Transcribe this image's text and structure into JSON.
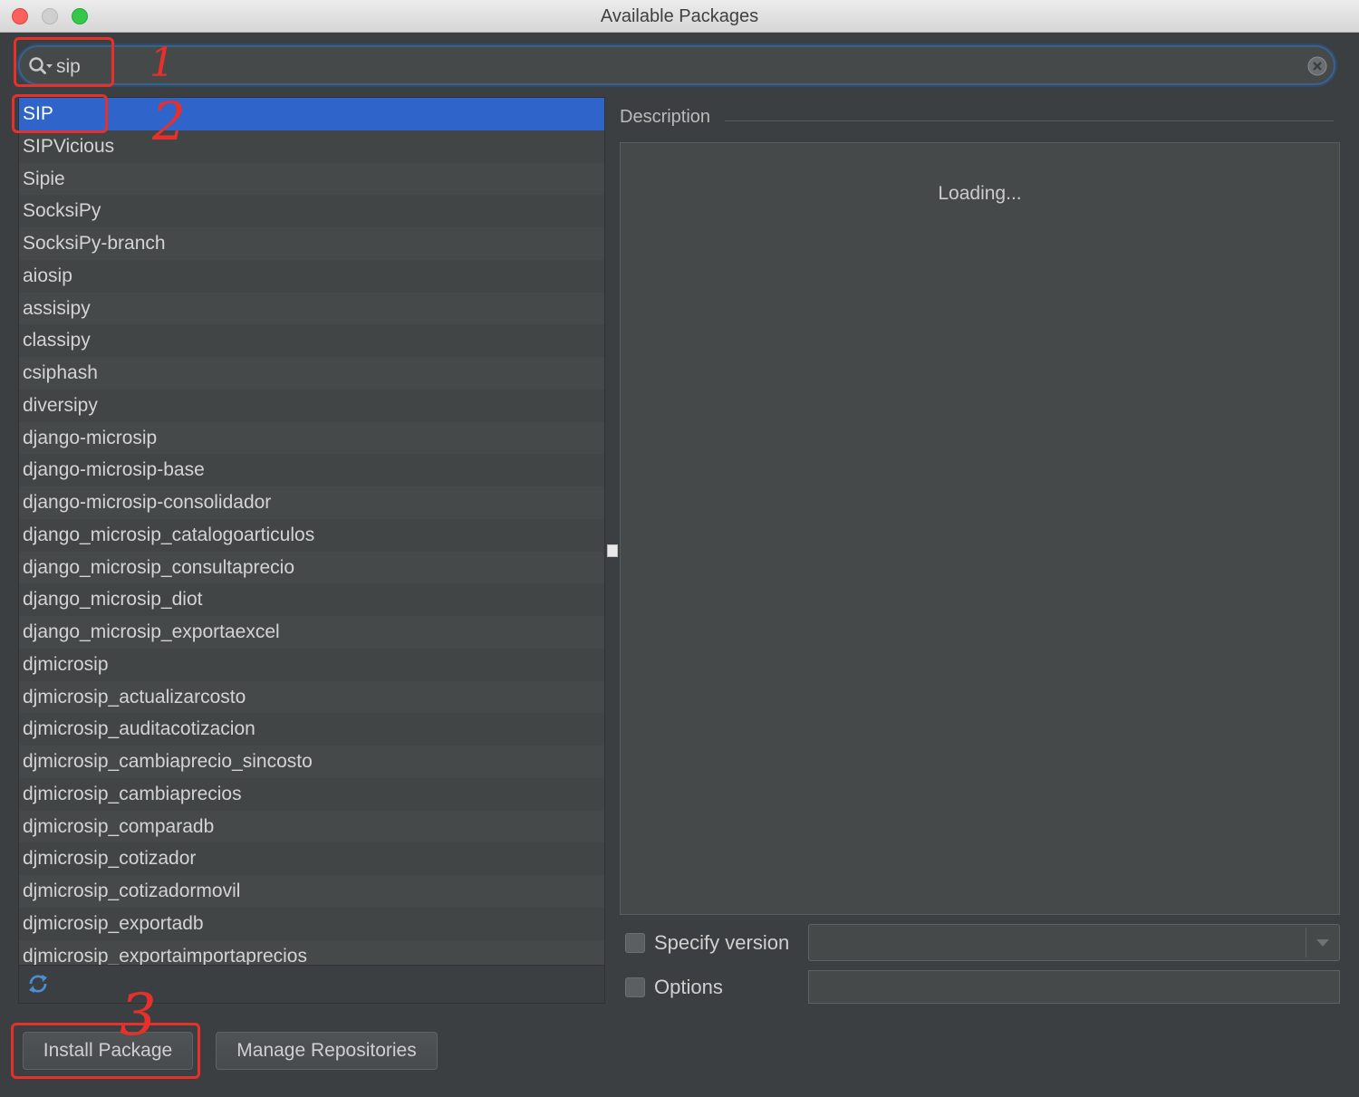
{
  "window": {
    "title": "Available Packages"
  },
  "search": {
    "value": "sip"
  },
  "packages": [
    "SIP",
    "SIPVicious",
    "Sipie",
    "SocksiPy",
    "SocksiPy-branch",
    "aiosip",
    "assisipy",
    "classipy",
    "csiphash",
    "diversipy",
    "django-microsip",
    "django-microsip-base",
    "django-microsip-consolidador",
    "django_microsip_catalogoarticulos",
    "django_microsip_consultaprecio",
    "django_microsip_diot",
    "django_microsip_exportaexcel",
    "djmicrosip",
    "djmicrosip_actualizarcosto",
    "djmicrosip_auditacotizacion",
    "djmicrosip_cambiaprecio_sincosto",
    "djmicrosip_cambiaprecios",
    "djmicrosip_comparadb",
    "djmicrosip_cotizador",
    "djmicrosip_cotizadormovil",
    "djmicrosip_exportadb",
    "djmicrosip_exportaimportaprecios"
  ],
  "selected_index": 0,
  "description": {
    "label": "Description",
    "loading": "Loading..."
  },
  "specify_version": {
    "label": "Specify version",
    "checked": false
  },
  "options": {
    "label": "Options",
    "checked": false
  },
  "buttons": {
    "install": "Install Package",
    "manage": "Manage Repositories"
  },
  "annotations": {
    "marks": [
      "1",
      "2",
      "3"
    ],
    "color": "#e8302a"
  },
  "colors": {
    "selection": "#2f65ca",
    "background": "#3c3f41",
    "panel": "#45494a"
  }
}
